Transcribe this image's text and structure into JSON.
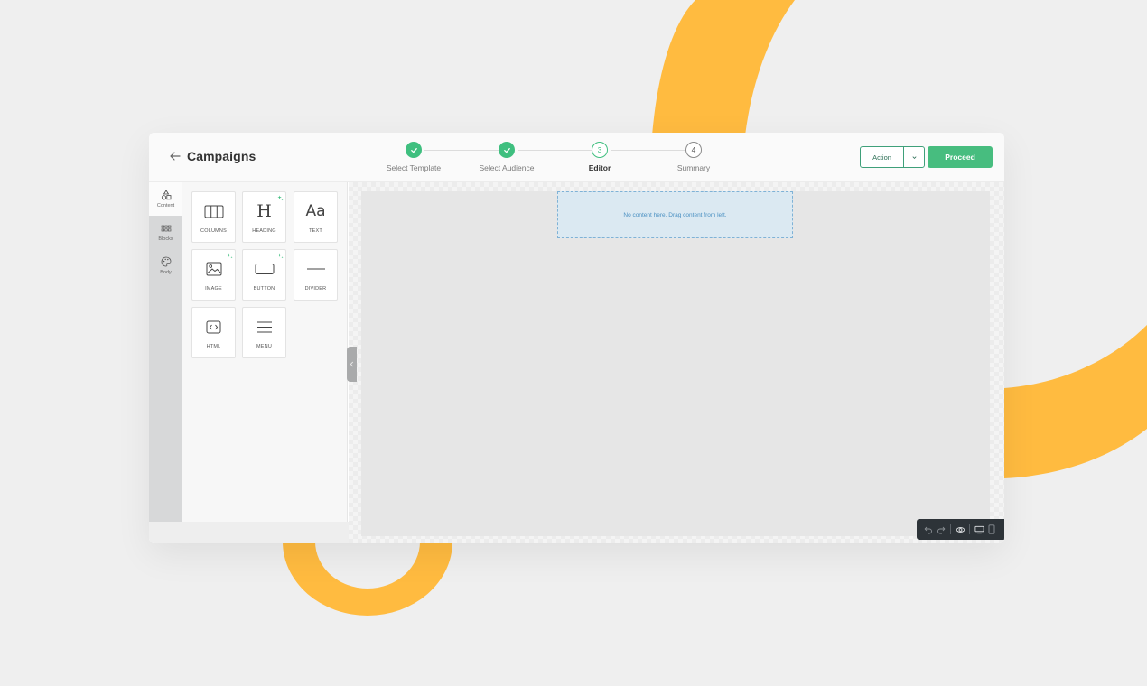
{
  "header": {
    "back_title": "Campaigns",
    "steps": [
      {
        "label": "Select Template",
        "state": "done",
        "number": ""
      },
      {
        "label": "Select Audience",
        "state": "done",
        "number": ""
      },
      {
        "label": "Editor",
        "state": "current",
        "number": "3"
      },
      {
        "label": "Summary",
        "state": "todo",
        "number": "4"
      }
    ],
    "action_label": "Action",
    "proceed_label": "Proceed"
  },
  "rail": {
    "items": [
      {
        "label": "Content",
        "icon": "shapes-icon",
        "active": true
      },
      {
        "label": "Blocks",
        "icon": "grid-dots-icon",
        "active": false
      },
      {
        "label": "Body",
        "icon": "palette-icon",
        "active": false
      }
    ]
  },
  "tools": {
    "items": [
      {
        "label": "COLUMNS",
        "icon": "columns-icon",
        "sparkle": false
      },
      {
        "label": "HEADING",
        "icon": "heading-icon",
        "sparkle": true
      },
      {
        "label": "TEXT",
        "icon": "text-icon",
        "sparkle": false
      },
      {
        "label": "IMAGE",
        "icon": "image-icon",
        "sparkle": true
      },
      {
        "label": "BUTTON",
        "icon": "button-icon",
        "sparkle": true
      },
      {
        "label": "DIVIDER",
        "icon": "divider-icon",
        "sparkle": false
      },
      {
        "label": "HTML",
        "icon": "html-icon",
        "sparkle": false
      },
      {
        "label": "MENU",
        "icon": "menu-icon",
        "sparkle": false
      }
    ],
    "heading_glyph": "H",
    "text_glyph": "Aa"
  },
  "canvas": {
    "empty_message": "No content here. Drag content from left."
  },
  "colors": {
    "accent_green": "#47bd7f",
    "decor_orange": "#ffbb40",
    "drop_zone_bg": "#dbe9f2",
    "toolbar_dark": "#2d3338"
  }
}
